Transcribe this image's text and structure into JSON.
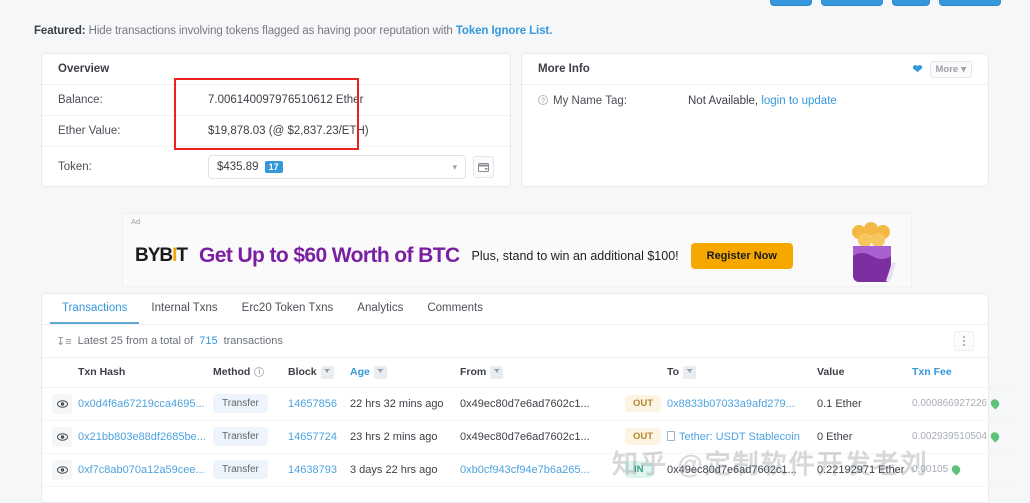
{
  "top_buttons": [
    "",
    "",
    "",
    ""
  ],
  "featured": {
    "label": "Featured:",
    "text": "Hide transactions involving tokens flagged as having poor reputation with",
    "link": "Token Ignore List."
  },
  "overview": {
    "title": "Overview",
    "balance_label": "Balance:",
    "balance_value": "7.006140097976510612 Ether",
    "ether_value_label": "Ether Value:",
    "ether_value": "$19,878.03 (@ $2,837.23/ETH)",
    "token_label": "Token:",
    "token_value": "$435.89",
    "token_count": "17",
    "chevron": "chevron-down-icon"
  },
  "more_info": {
    "title": "More Info",
    "more_label": "More",
    "name_tag_label": "My Name Tag:",
    "name_tag_value": "Not Available,",
    "name_tag_link": "login to update"
  },
  "ad": {
    "tag": "Ad",
    "brand": "BYB",
    "brand_dot": "I",
    "brand_end": "T",
    "headline": "Get Up to $60 Worth of BTC",
    "subline": "Plus, stand to win an additional $100!",
    "cta": "Register Now"
  },
  "tabs": [
    {
      "label": "Transactions",
      "active": true
    },
    {
      "label": "Internal Txns",
      "active": false
    },
    {
      "label": "Erc20 Token Txns",
      "active": false
    },
    {
      "label": "Analytics",
      "active": false
    },
    {
      "label": "Comments",
      "active": false
    }
  ],
  "subbar": {
    "prefix": "Latest 25 from a total of",
    "count": "715",
    "suffix": "transactions"
  },
  "table": {
    "headers": {
      "txn_hash": "Txn Hash",
      "method": "Method",
      "block": "Block",
      "age": "Age",
      "from": "From",
      "to": "To",
      "value": "Value",
      "txn_fee": "Txn Fee"
    },
    "rows": [
      {
        "hash": "0x0d4f6a67219cca4695...",
        "method": "Transfer",
        "block": "14657856",
        "age": "22 hrs 32 mins ago",
        "from": "0x49ec80d7e6ad7602c1...",
        "direction": "OUT",
        "to": "0x8833b07033a9afd279...",
        "to_is_link": true,
        "to_has_icon": false,
        "value": "0.1 Ether",
        "fee": "0.000866927226"
      },
      {
        "hash": "0x21bb803e88df2685be...",
        "method": "Transfer",
        "block": "14657724",
        "age": "23 hrs 2 mins ago",
        "from": "0x49ec80d7e6ad7602c1...",
        "direction": "OUT",
        "to": "Tether: USDT Stablecoin",
        "to_is_link": true,
        "to_has_icon": true,
        "value": "0 Ether",
        "fee": "0.002939510504"
      },
      {
        "hash": "0xf7c8ab070a12a59cee...",
        "method": "Transfer",
        "block": "14638793",
        "age": "3 days 22 hrs ago",
        "from": "0xb0cf943cf94e7b6a265...",
        "direction": "IN",
        "to": "0x49ec80d7e6ad7602c1...",
        "to_is_link": false,
        "to_has_icon": false,
        "value": "0.22192971 Ether",
        "fee": "0.00105"
      }
    ]
  },
  "watermark": "知乎 @定制软件开发老刘",
  "colors": {
    "accent": "#3498db",
    "annotation": "#e8221c",
    "out_badge": "#b4872e",
    "in_badge": "#3c9e86",
    "ad_purple": "#7b1fa2",
    "ad_orange": "#f6a800"
  }
}
